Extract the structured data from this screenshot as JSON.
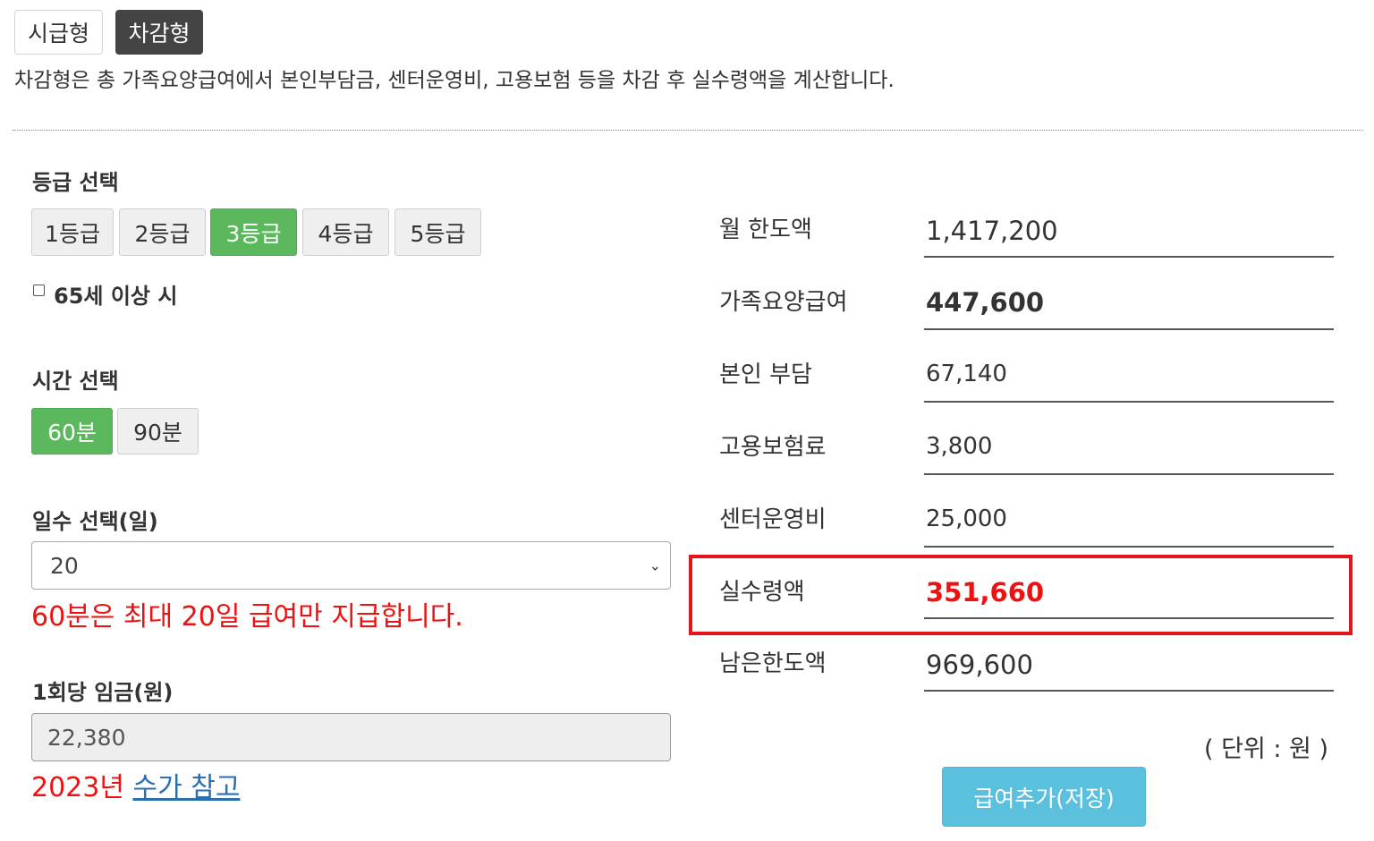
{
  "mode_tabs": [
    {
      "label": "시급형",
      "active": false
    },
    {
      "label": "차감형",
      "active": true
    }
  ],
  "description": "차감형은 총 가족요양급여에서 본인부담금, 센터운영비, 고용보험 등을 차감 후 실수령액을 계산합니다.",
  "grade": {
    "title": "등급 선택",
    "options": [
      "1등급",
      "2등급",
      "3등급",
      "4등급",
      "5등급"
    ],
    "selected": "3등급"
  },
  "age_checkbox": {
    "label": "65세 이상 시",
    "checked": false
  },
  "time": {
    "title": "시간 선택",
    "options": [
      "60분",
      "90분"
    ],
    "selected": "60분"
  },
  "days": {
    "title": "일수 선택(일)",
    "value": "20",
    "note": "60분은 최대 20일 급여만 지급합니다."
  },
  "wage": {
    "title": "1회당 임금(원)",
    "value": "22,380",
    "year_note": "2023년",
    "link_text": "수가 참고"
  },
  "results": [
    {
      "label": "월 한도액",
      "value": "1,417,200"
    },
    {
      "label": "가족요양급여",
      "value": "447,600"
    },
    {
      "label": "본인 부담",
      "value": "67,140"
    },
    {
      "label": "고용보험료",
      "value": "3,800"
    },
    {
      "label": "센터운영비",
      "value": "25,000"
    },
    {
      "label": "실수령액",
      "value": "351,660"
    },
    {
      "label": "남은한도액",
      "value": "969,600"
    }
  ],
  "unit_text": "( 단위 : 원 )",
  "save_button": "급여추가(저장)",
  "colors": {
    "accent_green": "#5cb85c",
    "highlight_red": "#e8121a",
    "save_blue": "#5bc0de",
    "dark_tab": "#444444"
  }
}
